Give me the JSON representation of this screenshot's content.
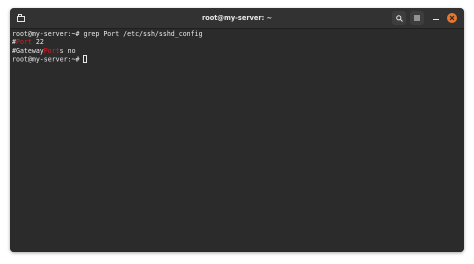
{
  "window": {
    "title": "root@my-server: ~"
  },
  "headerbar": {
    "new_tab_icon": "new-tab-icon",
    "search_icon": "search-icon",
    "menu_icon": "hamburger-menu-icon",
    "minimize_icon": "minimize-icon",
    "close_icon": "close-icon",
    "close_color": "#e9772d"
  },
  "terminal": {
    "line1": {
      "prompt": "root@my-server:~# ",
      "command": "grep Port /etc/ssh/sshd_config"
    },
    "line2": {
      "prefix": "#",
      "match": "Port",
      "suffix": " 22"
    },
    "line3": {
      "prefix": "#Gateway",
      "match": "Port",
      "suffix": "s no"
    },
    "line4": {
      "prompt": "root@my-server:~# "
    },
    "match_color": "#e01b24",
    "text_color": "#e8e8e8",
    "background": "#2b2b2b"
  }
}
